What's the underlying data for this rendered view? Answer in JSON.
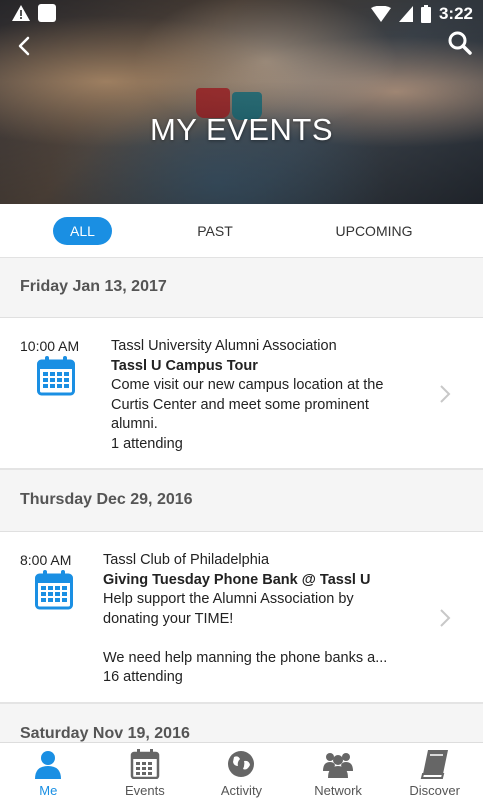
{
  "status_bar": {
    "time": "3:22"
  },
  "header": {
    "title": "MY EVENTS"
  },
  "filters": {
    "all": "ALL",
    "past": "PAST",
    "upcoming": "UPCOMING",
    "selected": "ALL"
  },
  "groups": [
    {
      "date": "Friday Jan 13, 2017",
      "events": [
        {
          "time": "10:00 AM",
          "organizer": "Tassl University Alumni Association",
          "title": "Tassl U Campus Tour",
          "description_lines": [
            "Come visit our new campus location at the",
            "Curtis Center and meet some prominent",
            "alumni."
          ],
          "attending": "1 attending"
        }
      ]
    },
    {
      "date": "Thursday Dec 29, 2016",
      "events": [
        {
          "time": "8:00 AM",
          "organizer": "Tassl Club of Philadelphia",
          "title": "Giving Tuesday Phone Bank @ Tassl U",
          "description_lines": [
            "Help support the Alumni Association by",
            "donating your TIME!",
            "",
            "We need help manning the phone banks a..."
          ],
          "attending": "16 attending"
        }
      ]
    },
    {
      "date": "Saturday Nov 19, 2016",
      "events": []
    }
  ],
  "bottom_nav": [
    {
      "label": "Me",
      "icon": "person-icon",
      "active": true
    },
    {
      "label": "Events",
      "icon": "calendar-icon",
      "active": false
    },
    {
      "label": "Activity",
      "icon": "globe-icon",
      "active": false
    },
    {
      "label": "Network",
      "icon": "group-icon",
      "active": false
    },
    {
      "label": "Discover",
      "icon": "book-icon",
      "active": false
    }
  ],
  "colors": {
    "accent": "#1a8fe3",
    "header_bg": "#f5f5f5",
    "divider": "#e0e0e0"
  }
}
